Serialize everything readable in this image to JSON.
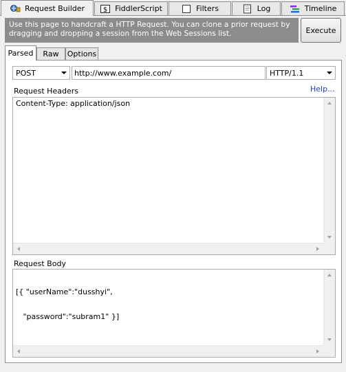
{
  "tabs": [
    {
      "label": "Request Builder",
      "icon": "request-builder-icon"
    },
    {
      "label": "FiddlerScript",
      "icon": "fiddlerscript-icon"
    },
    {
      "label": "Filters",
      "icon": "filters-checkbox-icon"
    },
    {
      "label": "Log",
      "icon": "log-icon"
    },
    {
      "label": "Timeline",
      "icon": "timeline-icon"
    }
  ],
  "info": {
    "line1": "Use this page to handcraft a HTTP Request. You can clone a prior request by",
    "line2": "dragging and dropping a session from the Web Sessions list."
  },
  "execute_label": "Execute",
  "subtabs": [
    "Parsed",
    "Raw",
    "Options"
  ],
  "request": {
    "method": "POST",
    "url": "http://www.example.com/",
    "version": "HTTP/1.1"
  },
  "headers": {
    "label": "Request Headers",
    "help": "Help...",
    "text": "Content-Type: application/json"
  },
  "body": {
    "label": "Request Body",
    "line1": "[{ \"userName\":\"dusshyi\",",
    "line2": "   \"password\":\"subram1\" }]"
  },
  "colors": {
    "info_bg": "#8c8c8c",
    "link": "#1a3ebf",
    "window_bg": "#f0f0f0"
  }
}
